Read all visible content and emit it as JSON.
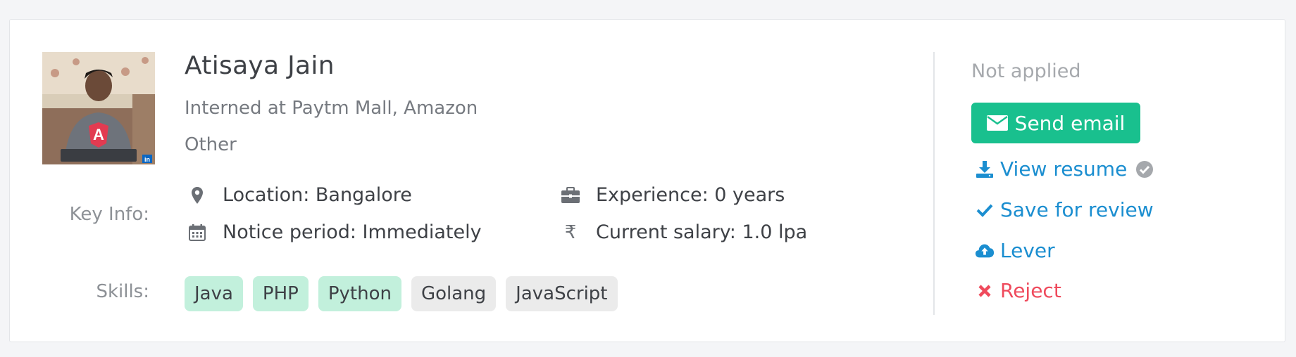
{
  "candidate": {
    "name": "Atisaya Jain",
    "internship": "Interned at Paytm Mall, Amazon",
    "category": "Other",
    "avatar_badge": "in"
  },
  "labels": {
    "key_info": "Key Info:",
    "skills": "Skills:"
  },
  "key_info": {
    "location": "Location: Bangalore",
    "notice_period": "Notice period: Immediately",
    "experience": "Experience: 0 years",
    "current_salary": "Current salary: 1.0 lpa",
    "rupee_symbol": "₹"
  },
  "skills": [
    {
      "label": "Java",
      "highlighted": true
    },
    {
      "label": "PHP",
      "highlighted": true
    },
    {
      "label": "Python",
      "highlighted": true
    },
    {
      "label": "Golang",
      "highlighted": false
    },
    {
      "label": "JavaScript",
      "highlighted": false
    }
  ],
  "sidebar": {
    "status": "Not applied",
    "send_email": "Send email",
    "view_resume": "View resume",
    "save_for_review": "Save for review",
    "lever": "Lever",
    "reject": "Reject"
  },
  "icons": {
    "location": "map-pin-icon",
    "notice": "calendar-icon",
    "experience": "briefcase-icon",
    "salary": "rupee-icon",
    "email": "envelope-icon",
    "resume": "download-icon",
    "verified": "check-circle-icon",
    "save": "check-icon",
    "lever": "cloud-upload-icon",
    "reject": "x-icon"
  },
  "colors": {
    "primary_green": "#19c08e",
    "link_blue": "#1b8ed0",
    "reject_red": "#ef4a5c",
    "chip_highlight": "#c2f0dc",
    "chip_plain": "#ebebeb"
  }
}
